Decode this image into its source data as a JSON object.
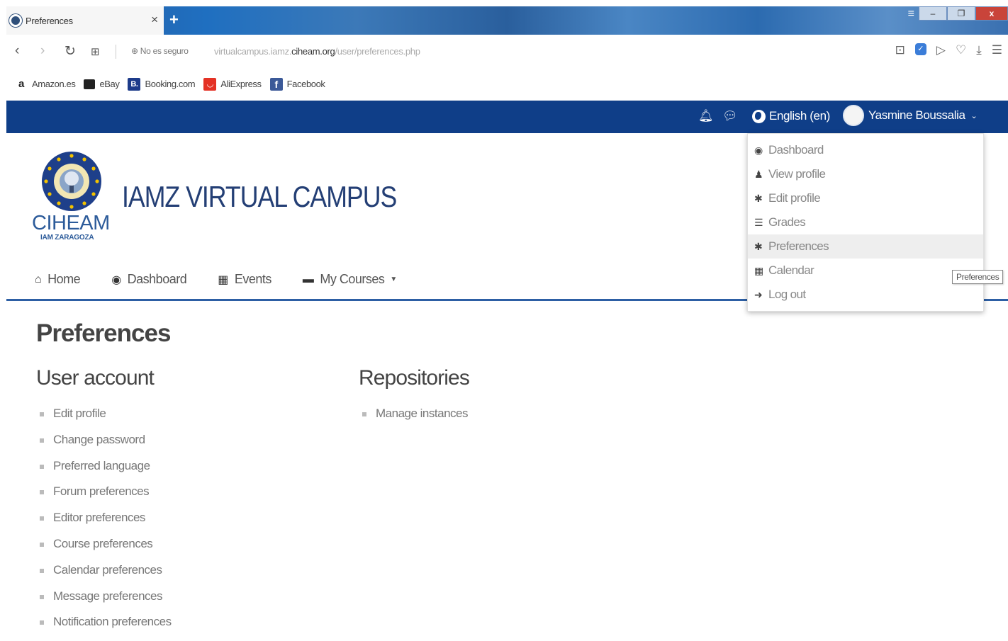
{
  "browser": {
    "tab_title": "Preferences",
    "tab_close": "×",
    "new_tab": "+",
    "security_label": "No es seguro",
    "url_prefix": "virtualcampus.iamz.",
    "url_domain": "ciheam.org",
    "url_path": "/user/preferences.php",
    "window_controls": [
      "–",
      "❐",
      "x"
    ]
  },
  "bookmarks": [
    {
      "label": "Amazon.es",
      "icon": "amazon-icon",
      "color": "#ffffff",
      "glyph": "a"
    },
    {
      "label": "eBay",
      "icon": "ebay-bag-icon",
      "color": "#333333",
      "glyph": "▮"
    },
    {
      "label": "Booking.com",
      "icon": "booking-icon",
      "color": "#1d3b8a",
      "glyph": "B."
    },
    {
      "label": "AliExpress",
      "icon": "aliexpress-icon",
      "color": "#e43225",
      "glyph": "◡"
    },
    {
      "label": "Facebook",
      "icon": "facebook-icon",
      "color": "#3b5998",
      "glyph": "f"
    }
  ],
  "topbar": {
    "language": "English (en)",
    "user_name": "Yasmine Boussalia",
    "bg_color": "#0f3e88"
  },
  "site": {
    "logo_text": "CIHEAM",
    "logo_sub": "IAM ZARAGOZA",
    "title": "IAMZ VIRTUAL CAMPUS"
  },
  "nav": [
    {
      "label": "Home",
      "icon": "home-icon",
      "glyph": "⌂"
    },
    {
      "label": "Dashboard",
      "icon": "dashboard-icon",
      "glyph": "◉"
    },
    {
      "label": "Events",
      "icon": "calendar-icon",
      "glyph": "▦"
    },
    {
      "label": "My Courses",
      "icon": "briefcase-icon",
      "glyph": "▬"
    }
  ],
  "page": {
    "title": "Preferences",
    "user_account": {
      "heading": "User account",
      "links": [
        "Edit profile",
        "Change password",
        "Preferred language",
        "Forum preferences",
        "Editor preferences",
        "Course preferences",
        "Calendar preferences",
        "Message preferences",
        "Notification preferences"
      ]
    },
    "repositories": {
      "heading": "Repositories",
      "links": [
        "Manage instances"
      ]
    }
  },
  "user_menu": [
    {
      "label": "Dashboard",
      "icon": "dashboard-icon",
      "glyph": "◉"
    },
    {
      "label": "View profile",
      "icon": "user-icon",
      "glyph": "♟"
    },
    {
      "label": "Edit profile",
      "icon": "cog-icon",
      "glyph": "✱"
    },
    {
      "label": "Grades",
      "icon": "table-icon",
      "glyph": "☰"
    },
    {
      "label": "Preferences",
      "icon": "cog-icon",
      "glyph": "✱"
    },
    {
      "label": "Calendar",
      "icon": "calendar-icon",
      "glyph": "▦"
    },
    {
      "label": "Log out",
      "icon": "sign-out-icon",
      "glyph": "➜"
    }
  ],
  "tooltip": "Preferences"
}
